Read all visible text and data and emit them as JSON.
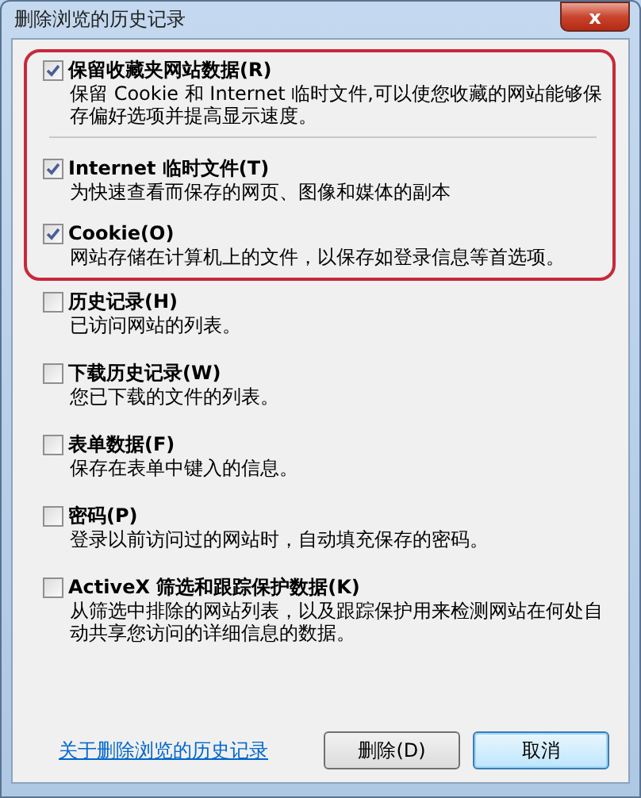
{
  "window": {
    "title": "删除浏览的历史记录",
    "close": "x"
  },
  "highlighted_items": [
    {
      "label": "保留收藏夹网站数据(R)",
      "description": "保留 Cookie 和 Internet 临时文件,可以使您收藏的网站能够保存偏好选项并提高显示速度。",
      "checked": true,
      "divider_after": true
    },
    {
      "label": "Internet 临时文件(T)",
      "description": "为快速查看而保存的网页、图像和媒体的副本",
      "checked": true,
      "divider_after": false
    },
    {
      "label": "Cookie(O)",
      "description": "网站存储在计算机上的文件，以保存如登录信息等首选项。",
      "checked": true,
      "divider_after": false
    }
  ],
  "items": [
    {
      "label": "历史记录(H)",
      "description": "已访问网站的列表。",
      "checked": false
    },
    {
      "label": "下载历史记录(W)",
      "description": "您已下载的文件的列表。",
      "checked": false
    },
    {
      "label": "表单数据(F)",
      "description": "保存在表单中键入的信息。",
      "checked": false
    },
    {
      "label": "密码(P)",
      "description": "登录以前访问过的网站时，自动填充保存的密码。",
      "checked": false
    },
    {
      "label": "ActiveX 筛选和跟踪保护数据(K)",
      "description": "从筛选中排除的网站列表，以及跟踪保护用来检测网站在何处自动共享您访问的详细信息的数据。",
      "checked": false
    }
  ],
  "link": "关于删除浏览的历史记录",
  "buttons": [
    {
      "label": "删除(D)",
      "default": false
    },
    {
      "label": "取消",
      "default": true
    }
  ]
}
